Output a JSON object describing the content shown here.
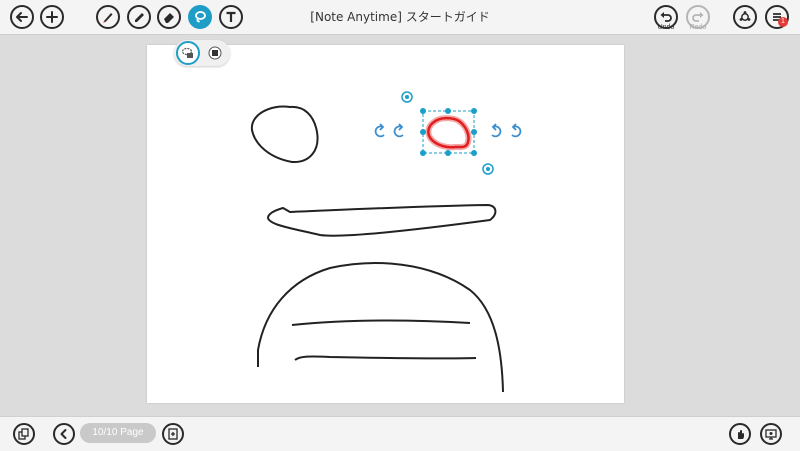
{
  "app": {
    "title": "[Note Anytime] スタートガイド"
  },
  "toolbar": {
    "undo_label": "Undo",
    "redo_label": "Redo",
    "notification_count": "1"
  },
  "footer": {
    "page_indicator": "10/10 Page"
  },
  "colors": {
    "accent": "#1e9ec6",
    "selection_handle": "#1a9fc9",
    "selected_stroke": "#e01e1e",
    "ink": "#222222",
    "notification_badge": "#e53935"
  },
  "icons": {
    "back": "arrow-left-icon",
    "add": "plus-icon",
    "pen": "pen-icon",
    "marker": "marker-icon",
    "eraser": "eraser-icon",
    "lasso": "lasso-icon",
    "text": "text-icon",
    "undo": "undo-icon",
    "redo": "redo-icon",
    "share": "share-icon",
    "menu": "menu-icon",
    "pages": "pages-icon",
    "prev": "chevron-left-icon",
    "add_page": "add-page-icon",
    "hand": "hand-icon",
    "present": "present-icon"
  }
}
